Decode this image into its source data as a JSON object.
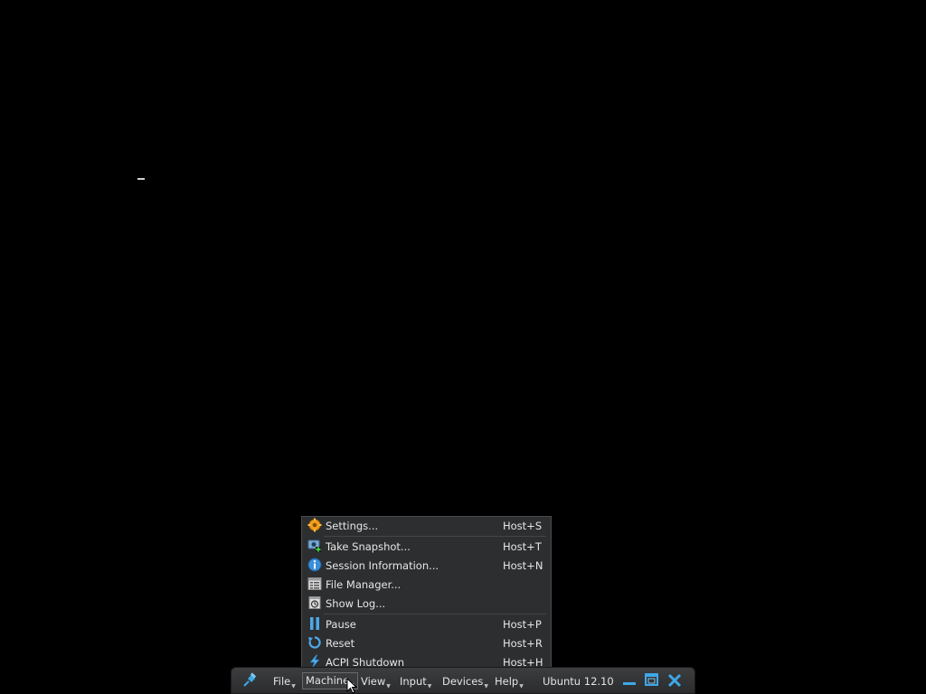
{
  "toolbar": {
    "menus": [
      {
        "label": "File"
      },
      {
        "label": "Machine"
      },
      {
        "label": "View"
      },
      {
        "label": "Input"
      },
      {
        "label": "Devices"
      },
      {
        "label": "Help"
      }
    ],
    "vm_name": "Ubuntu 12.10",
    "icons": [
      "pin-icon",
      "minimize-icon",
      "restore-icon",
      "close-icon"
    ],
    "active_menu": "Machine"
  },
  "machine_menu": {
    "items": [
      {
        "label": "Settings...",
        "shortcut": "Host+S",
        "icon": "settings-gear-icon"
      },
      {
        "label": "Take Snapshot...",
        "shortcut": "Host+T",
        "icon": "snapshot-camera-icon"
      },
      {
        "label": "Session Information...",
        "shortcut": "Host+N",
        "icon": "info-icon"
      },
      {
        "label": "File Manager...",
        "shortcut": "",
        "icon": "file-manager-icon"
      },
      {
        "label": "Show Log...",
        "shortcut": "",
        "icon": "show-log-icon"
      },
      {
        "label": "Pause",
        "shortcut": "Host+P",
        "icon": "pause-icon"
      },
      {
        "label": "Reset",
        "shortcut": "Host+R",
        "icon": "reset-icon"
      },
      {
        "label": "ACPI Shutdown",
        "shortcut": "Host+H",
        "icon": "acpi-shutdown-icon"
      }
    ]
  },
  "colors": {
    "background": "#000000",
    "toolbar": "#2f3032",
    "menu_bg": "#2d2e30",
    "text": "#e6e6e6",
    "accent_blue": "#3ea8e8",
    "settings_orange": "#f0a020"
  }
}
